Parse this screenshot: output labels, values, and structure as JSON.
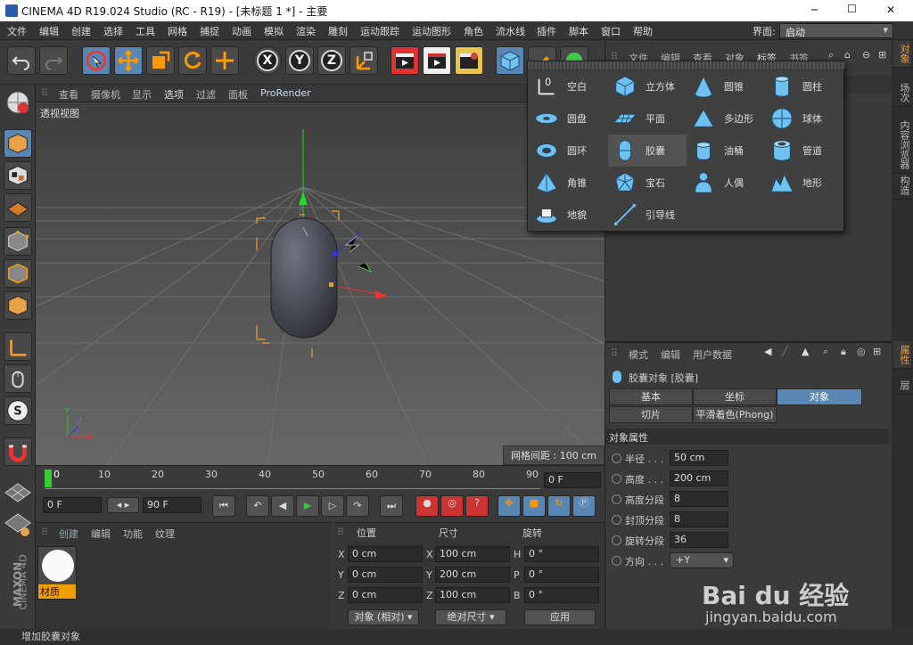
{
  "window": {
    "title": "CINEMA 4D R19.024 Studio (RC - R19) - [未标题 1 *] - 主要",
    "minimize": "─",
    "maximize": "☐",
    "close": "✕"
  },
  "menubar": {
    "items": [
      "文件",
      "编辑",
      "创建",
      "选择",
      "工具",
      "网格",
      "捕捉",
      "动画",
      "模拟",
      "渲染",
      "雕刻",
      "运动跟踪",
      "运动图形",
      "角色",
      "流水线",
      "插件",
      "脚本",
      "窗口",
      "帮助"
    ],
    "layout_label": "界面:",
    "layout_value": "启动"
  },
  "toolbar": {
    "x_label": "X",
    "y_label": "Y",
    "z_label": "Z"
  },
  "viewport": {
    "menu": [
      "查看",
      "摄像机",
      "显示",
      "选项",
      "过滤",
      "面板",
      "ProRender"
    ],
    "view_name": "透视视图",
    "grid_spacing": "网格间距 : 100 cm",
    "axis_y": "Y",
    "axis_z": "Z",
    "axis_x": "X"
  },
  "timeline": {
    "ticks": [
      "0",
      "10",
      "20",
      "30",
      "40",
      "50",
      "60",
      "70",
      "80",
      "90"
    ],
    "current_frame": "0 F"
  },
  "transport": {
    "start_frame": "0 F",
    "end_frame": "90 F"
  },
  "material": {
    "tabs": [
      "创建",
      "编辑",
      "功能",
      "纹理"
    ],
    "swatch_label": "材质"
  },
  "coords": {
    "headers": [
      "位置",
      "尺寸",
      "旋转"
    ],
    "rows": [
      {
        "axis": "X",
        "pos": "0 cm",
        "size_axis": "X",
        "size": "100 cm",
        "rot_axis": "H",
        "rot": "0 °"
      },
      {
        "axis": "Y",
        "pos": "0 cm",
        "size_axis": "Y",
        "size": "200 cm",
        "rot_axis": "P",
        "rot": "0 °"
      },
      {
        "axis": "Z",
        "pos": "0 cm",
        "size_axis": "Z",
        "size": "100 cm",
        "rot_axis": "B",
        "rot": "0 °"
      }
    ],
    "mode": "对象 (相对)",
    "size_mode": "绝对尺寸",
    "apply": "应用"
  },
  "object_manager": {
    "menu": [
      "文件",
      "编辑",
      "查看",
      "对象",
      "标签",
      "书签"
    ]
  },
  "side_tabs": [
    "对象",
    "场次",
    "内容浏览器",
    "构造",
    "属性",
    "层"
  ],
  "popup": {
    "items": [
      {
        "label": "空白"
      },
      {
        "label": "立方体"
      },
      {
        "label": "圆锥"
      },
      {
        "label": "圆柱"
      },
      {
        "label": "圆盘"
      },
      {
        "label": "平面"
      },
      {
        "label": "多边形"
      },
      {
        "label": "球体"
      },
      {
        "label": "圆环"
      },
      {
        "label": "胶囊"
      },
      {
        "label": "油桶"
      },
      {
        "label": "管道"
      },
      {
        "label": "角锥"
      },
      {
        "label": "宝石"
      },
      {
        "label": "人偶"
      },
      {
        "label": "地形"
      },
      {
        "label": "地貌"
      },
      {
        "label": "引导线"
      }
    ]
  },
  "attributes": {
    "menu": [
      "模式",
      "编辑",
      "用户数据"
    ],
    "object_title": "胶囊对象 [胶囊]",
    "tabs": [
      "基本",
      "坐标",
      "对象",
      "切片",
      "平滑着色(Phong)"
    ],
    "active_tab": "对象",
    "section": "对象属性",
    "props": [
      {
        "label": "半径 . . .",
        "value": "50 cm"
      },
      {
        "label": "高度 . . .",
        "value": "200 cm"
      },
      {
        "label": "高度分段",
        "value": "8"
      },
      {
        "label": "封顶分段",
        "value": "8"
      },
      {
        "label": "旋转分段",
        "value": "36"
      },
      {
        "label": "方向 . . .",
        "value": "+Y"
      }
    ]
  },
  "status": {
    "text": "增加胶囊对象"
  },
  "branding": {
    "maxon": "MAXON",
    "cinema": "CINEMA 4D",
    "watermark_logo": "Bai du 经验",
    "watermark_url": "jingyan.baidu.com"
  }
}
